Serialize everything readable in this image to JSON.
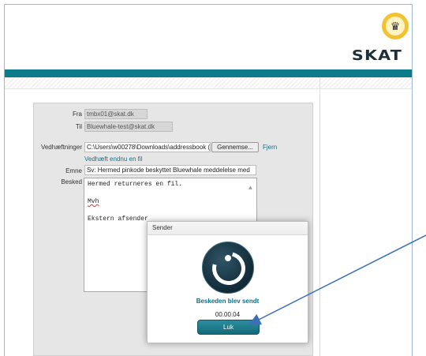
{
  "brand": {
    "name": "SKAT",
    "crown_icon": "crown-icon"
  },
  "form": {
    "from_label": "Fra",
    "from_value": "tmbx01@skat.dk",
    "to_label": "Til",
    "to_value": "Bluewhale-test@skat.dk",
    "attachments_label": "Vedhæftninger",
    "attachments_path": "C:\\Users\\w00278\\Downloads\\addressbook (",
    "browse_label": "Gennemse...",
    "remove_link": "Fjern",
    "attach_more_link": "Vedhæft endnu en fil",
    "subject_label": "Emne",
    "subject_value": "Sv: Hermed pinkode beskyttet Bluewhale meddelelse med",
    "message_label": "Besked",
    "message_lines": [
      "Hermed returneres en fil.",
      "",
      "Mvh",
      "",
      "Ekstern afsender"
    ]
  },
  "dialog": {
    "title": "Sender",
    "status": "Beskeden blev sendt",
    "timer": "00.00.04",
    "close_label": "Luk"
  },
  "colors": {
    "accent": "#0d7b8a",
    "status_text": "#0d6f84",
    "arrow": "#3b6fb6"
  }
}
